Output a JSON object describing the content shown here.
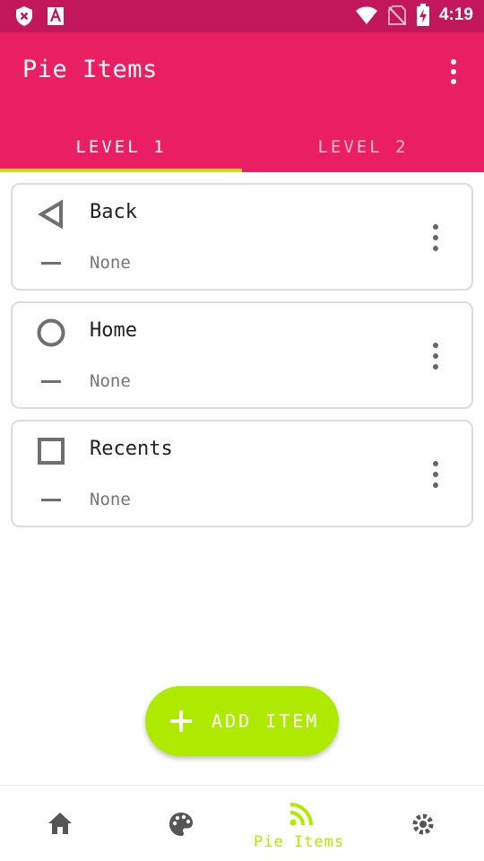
{
  "status_bar": {
    "time": "4:19",
    "left_icons": [
      "shield-x-icon",
      "font-a-icon"
    ],
    "right_icons": [
      "wifi-icon",
      "no-sim-icon",
      "battery-charging-icon"
    ]
  },
  "app_bar": {
    "title": "Pie Items",
    "menu_icon": "more-vert-icon",
    "background": "#e91e63"
  },
  "tabs": [
    {
      "label": "LEVEL 1",
      "selected": true
    },
    {
      "label": "LEVEL 2",
      "selected": false
    }
  ],
  "items": [
    {
      "icon": "back-triangle-icon",
      "label": "Back",
      "action_icon": "dash-icon",
      "action": "None"
    },
    {
      "icon": "home-circle-icon",
      "label": "Home",
      "action_icon": "dash-icon",
      "action": "None"
    },
    {
      "icon": "recents-square-icon",
      "label": "Recents",
      "action_icon": "dash-icon",
      "action": "None"
    }
  ],
  "fab": {
    "icon": "plus-icon",
    "label": "ADD ITEM",
    "color": "#aeea00"
  },
  "bottom_nav": {
    "items": [
      {
        "icon": "home-icon",
        "selected": false
      },
      {
        "icon": "palette-icon",
        "selected": false
      },
      {
        "icon": "rss-feed-icon",
        "label": "Pie Items",
        "selected": true
      },
      {
        "icon": "settings-icon",
        "selected": false
      }
    ],
    "accent": "#aeea00"
  }
}
